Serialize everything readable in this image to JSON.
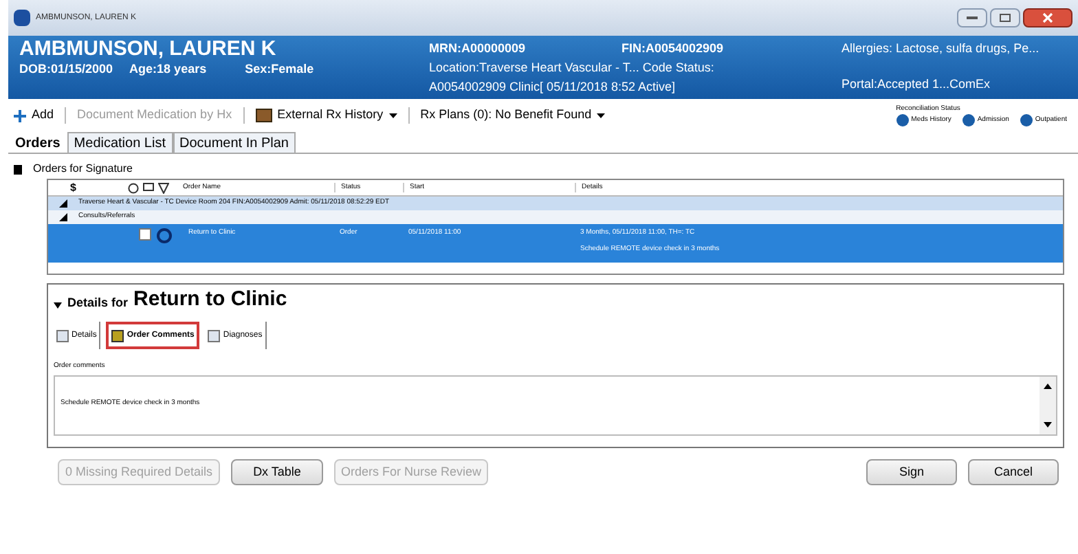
{
  "window": {
    "title": "AMBMUNSON, LAUREN K"
  },
  "banner": {
    "name": "AMBMUNSON, LAUREN K",
    "dob": "DOB:01/15/2000",
    "age": "Age:18 years",
    "sex": "Sex:Female",
    "mrn": "MRN:A00000009",
    "fin": "FIN:A0054002909",
    "location": "Location:Traverse Heart  Vascular - T...  Code Status:",
    "encounter": "A0054002909 Clinic[ 05/11/2018 8:52 Active]",
    "allergies": "Allergies: Lactose, sulfa drugs, Pe...",
    "portal": "Portal:Accepted 1...ComEx"
  },
  "toolbar": {
    "add": "Add",
    "document_medication": "Document Medication by Hx",
    "external_rx": "External Rx History",
    "rx_plans": "Rx Plans (0): No Benefit Found",
    "reconciliation_title": "Reconciliation Status",
    "reconciliation": [
      "Meds History",
      "Admission",
      "Outpatient"
    ]
  },
  "tabs": [
    {
      "label": "Orders",
      "selected": true
    },
    {
      "label": "Medication List",
      "selected": false
    },
    {
      "label": "Document In Plan",
      "selected": false
    }
  ],
  "orders_section": "Orders for Signature",
  "table": {
    "columns": [
      "$",
      "Order Name",
      "Status",
      "Start",
      "Details"
    ],
    "groups": [
      "Traverse Heart & Vascular - TC Device Room 204  FIN:A0054002909  Admit: 05/11/2018 08:52:29 EDT",
      "Consults/Referrals"
    ],
    "rows": [
      {
        "order_name": "Return to Clinic",
        "status": "Order",
        "start": "05/11/2018 11:00",
        "details": [
          "3 Months, 05/11/2018 11:00, TH=: TC",
          "Schedule REMOTE device check in 3 months"
        ],
        "selected": true,
        "checked": false
      }
    ]
  },
  "details": {
    "prefix": "Details for",
    "title": "Return to Clinic",
    "tabs": [
      {
        "label": "Details",
        "selected": false
      },
      {
        "label": "Order Comments",
        "selected": true
      },
      {
        "label": "Diagnoses",
        "selected": false
      }
    ],
    "comments_label": "Order comments",
    "comments_value": "Schedule REMOTE device check in 3 months"
  },
  "buttons": [
    {
      "label": "0 Missing Required Details",
      "disabled": true
    },
    {
      "label": "Dx Table",
      "disabled": false
    },
    {
      "label": "Orders For Nurse Review",
      "disabled": true
    }
  ],
  "actions": [
    {
      "label": "Sign",
      "disabled": false
    },
    {
      "label": "Cancel",
      "disabled": false
    }
  ]
}
